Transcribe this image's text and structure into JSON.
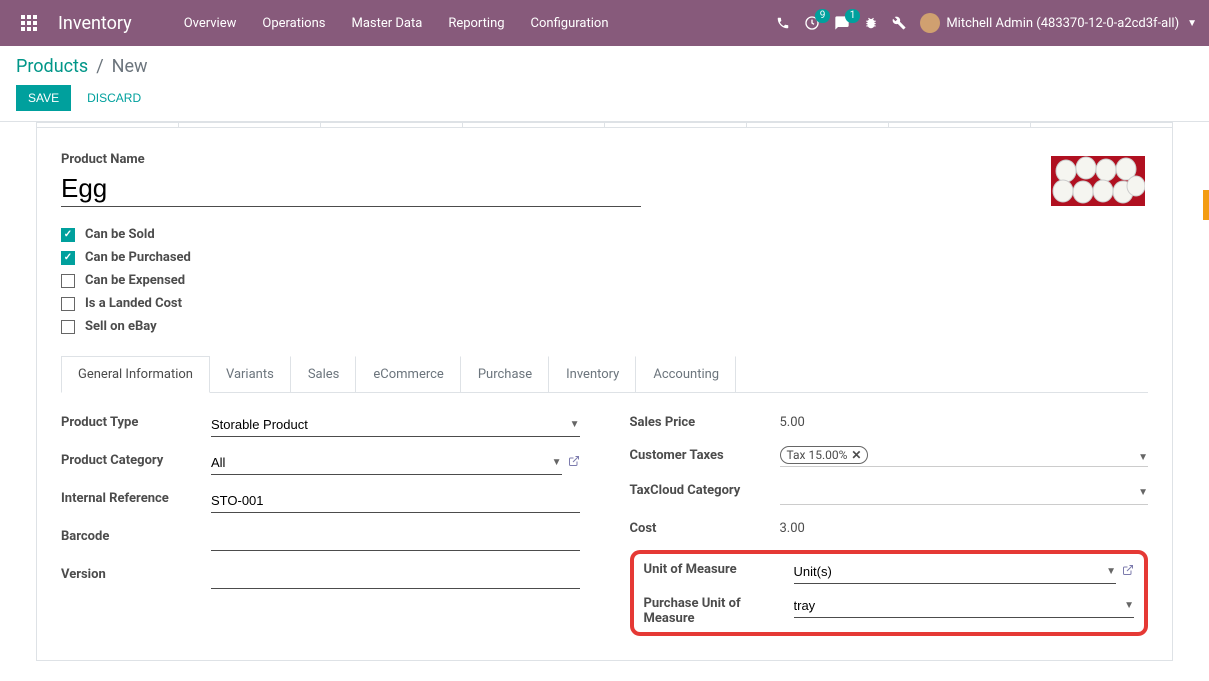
{
  "app_title": "Inventory",
  "nav": [
    "Overview",
    "Operations",
    "Master Data",
    "Reporting",
    "Configuration"
  ],
  "badges": {
    "activity": "9",
    "messages": "1"
  },
  "user": "Mitchell Admin (483370-12-0-a2cd3f-all)",
  "breadcrumb": {
    "link": "Products",
    "sep": "/",
    "current": "New"
  },
  "buttons": {
    "save": "SAVE",
    "discard": "DISCARD"
  },
  "product_name_label": "Product Name",
  "product_name": "Egg",
  "checks": [
    {
      "label": "Can be Sold",
      "checked": true
    },
    {
      "label": "Can be Purchased",
      "checked": true
    },
    {
      "label": "Can be Expensed",
      "checked": false
    },
    {
      "label": "Is a Landed Cost",
      "checked": false
    },
    {
      "label": "Sell on eBay",
      "checked": false
    }
  ],
  "tabs": [
    "General Information",
    "Variants",
    "Sales",
    "eCommerce",
    "Purchase",
    "Inventory",
    "Accounting"
  ],
  "active_tab": 0,
  "left": {
    "product_type": {
      "label": "Product Type",
      "value": "Storable Product"
    },
    "product_category": {
      "label": "Product Category",
      "value": "All"
    },
    "internal_ref": {
      "label": "Internal Reference",
      "value": "STO-001"
    },
    "barcode": {
      "label": "Barcode",
      "value": ""
    },
    "version": {
      "label": "Version",
      "value": ""
    }
  },
  "right": {
    "sales_price": {
      "label": "Sales Price",
      "value": "5.00"
    },
    "customer_taxes": {
      "label": "Customer Taxes",
      "value": "Tax 15.00%"
    },
    "taxcloud": {
      "label": "TaxCloud Category",
      "value": ""
    },
    "cost": {
      "label": "Cost",
      "value": "3.00"
    },
    "uom": {
      "label": "Unit of Measure",
      "value": "Unit(s)"
    },
    "purchase_uom": {
      "label": "Purchase Unit of Measure",
      "value": "tray"
    }
  }
}
